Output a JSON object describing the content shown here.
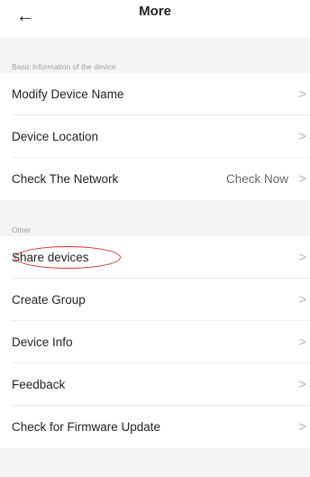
{
  "header": {
    "back_icon": "arrow-left-icon",
    "title": "More"
  },
  "sections": {
    "basic": {
      "label": "Basic information of the device",
      "items": {
        "modify_name": {
          "label": "Modify Device Name"
        },
        "location": {
          "label": "Device Location"
        },
        "network": {
          "label": "Check The Network",
          "value": "Check Now"
        }
      }
    },
    "other": {
      "label": "Other",
      "items": {
        "share": {
          "label": "Share devices"
        },
        "create_group": {
          "label": "Create Group"
        },
        "device_info": {
          "label": "Device Info"
        },
        "feedback": {
          "label": "Feedback"
        },
        "firmware": {
          "label": "Check for Firmware Update"
        }
      }
    }
  },
  "icons": {
    "chevron": "chevron-right-icon"
  },
  "colors": {
    "highlight": "#d9302c",
    "background": "#f5f5f5",
    "text": "#222222",
    "muted": "#9e9e9e"
  }
}
